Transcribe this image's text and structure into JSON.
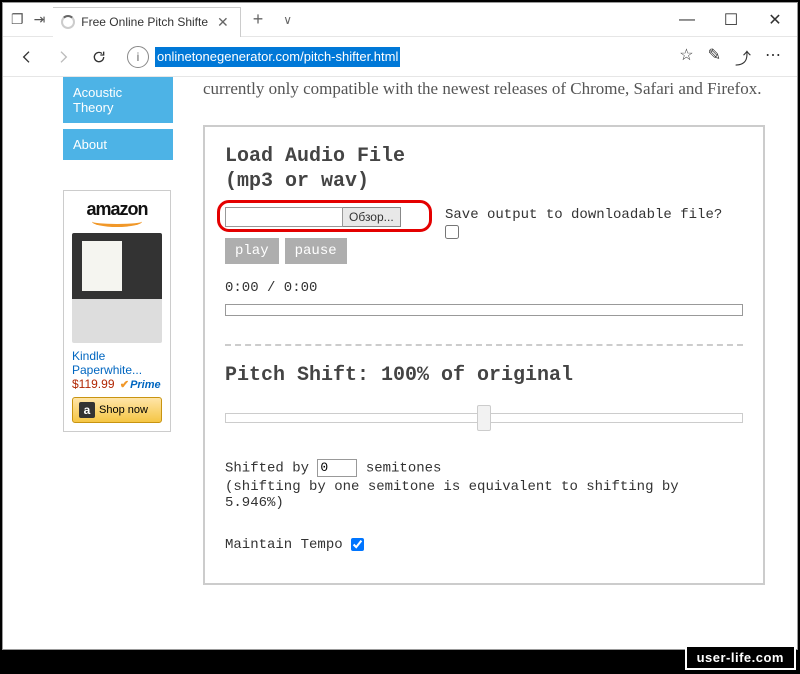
{
  "browser": {
    "tab_title": "Free Online Pitch Shifte",
    "url": "onlinetonegenerator.com/pitch-shifter.html"
  },
  "win_controls": {
    "min": "—",
    "max": "☐",
    "close": "✕"
  },
  "nav": {
    "new_tab": "+",
    "caret": "∨",
    "info": "i",
    "star": "☆",
    "pen": "✎",
    "share": "⤴",
    "more": "⋯"
  },
  "sidebar": {
    "items": [
      {
        "label": "Acoustic Theory"
      },
      {
        "label": "About"
      }
    ]
  },
  "ad": {
    "brand": "amazon",
    "title_line1": "Kindle",
    "title_line2": "Paperwhite...",
    "price": "$119.99",
    "prime": "Prime",
    "shop": "Shop now",
    "a": "a"
  },
  "main": {
    "intro": "currently only compatible with the newest releases of Chrome, Safari and Firefox.",
    "load_h1": "Load Audio File",
    "load_h2": "(mp3 or wav)",
    "browse_btn": "Обзор...",
    "save_label": "Save output to downloadable file?",
    "play": "play",
    "pause": "pause",
    "time": "0:00 / 0:00",
    "pitch_h": "Pitch Shift: 100% of original",
    "shifted_by": "Shifted by",
    "semitones_val": "0",
    "semitones_label": "semitones",
    "note": "(shifting by one semitone is equivalent to shifting by 5.946%)",
    "tempo": "Maintain Tempo"
  },
  "watermark": "user-life.com"
}
